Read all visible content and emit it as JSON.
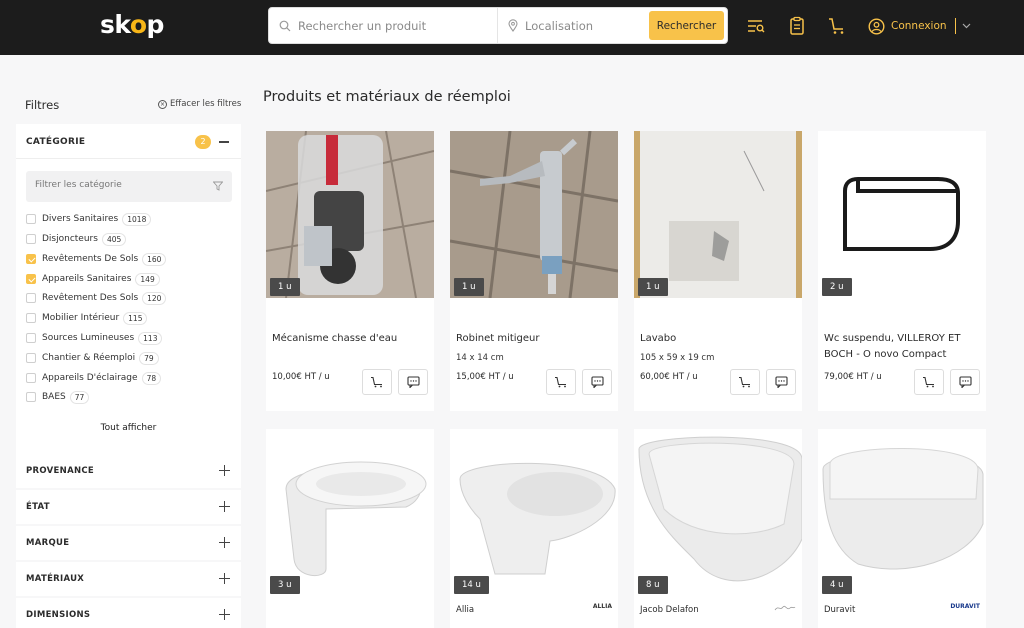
{
  "header": {
    "logo": "sk",
    "logo_o": "o",
    "logo_end": "p",
    "search_placeholder": "Rechercher un produit",
    "location_placeholder": "Localisation",
    "search_button": "Rechercher",
    "login_label": "Connexion"
  },
  "sidebar": {
    "title": "Filtres",
    "clear_label": "Effacer les filtres",
    "category": {
      "title": "CATÉGORIE",
      "badge": "2",
      "filter_placeholder": "Filtrer les catégorie",
      "items": [
        {
          "label": "Divers Sanitaires",
          "count": "1018",
          "checked": false
        },
        {
          "label": "Disjoncteurs",
          "count": "405",
          "checked": false
        },
        {
          "label": "Revêtements De Sols",
          "count": "160",
          "checked": true
        },
        {
          "label": "Appareils Sanitaires",
          "count": "149",
          "checked": true
        },
        {
          "label": "Revêtement Des Sols",
          "count": "120",
          "checked": false
        },
        {
          "label": "Mobilier Intérieur",
          "count": "115",
          "checked": false
        },
        {
          "label": "Sources Lumineuses",
          "count": "113",
          "checked": false
        },
        {
          "label": "Chantier & Réemploi",
          "count": "79",
          "checked": false
        },
        {
          "label": "Appareils D'éclairage",
          "count": "78",
          "checked": false
        },
        {
          "label": "BAES",
          "count": "77",
          "checked": false
        }
      ],
      "show_all": "Tout afficher"
    },
    "sections": [
      "PROVENANCE",
      "ÉTAT",
      "MARQUE",
      "MATÉRIAUX",
      "DIMENSIONS"
    ]
  },
  "main": {
    "title": "Produits et matériaux de réemploi",
    "products": [
      {
        "name": "Mécanisme chasse d'eau",
        "dims": "",
        "price": "10,00€ HT / u",
        "qty": "1 u"
      },
      {
        "name": "Robinet mitigeur",
        "dims": "14 x 14 cm",
        "price": "15,00€ HT / u",
        "qty": "1 u"
      },
      {
        "name": "Lavabo",
        "dims": "105 x 59 x 19 cm",
        "price": "60,00€ HT / u",
        "qty": "1 u"
      },
      {
        "name": "Wc suspendu, VILLEROY ET BOCH - O novo Compact",
        "dims": "",
        "price": "79,00€ HT / u",
        "qty": "2 u"
      }
    ],
    "products_row2": [
      {
        "qty": "3 u",
        "brand": "",
        "brand_logo": ""
      },
      {
        "qty": "14 u",
        "brand": "Allia",
        "brand_logo": "ALLIA"
      },
      {
        "qty": "8 u",
        "brand": "Jacob Delafon",
        "brand_logo": ""
      },
      {
        "qty": "4 u",
        "brand": "Duravit",
        "brand_logo": "DURAVIT"
      }
    ]
  }
}
